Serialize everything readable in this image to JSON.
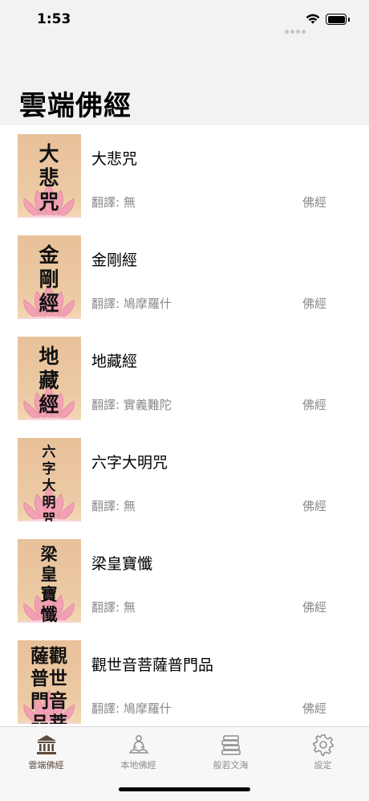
{
  "status": {
    "time": "1:53"
  },
  "nav": {
    "title": "雲端佛經"
  },
  "items": [
    {
      "thumb": "大悲咒",
      "title": "大悲咒",
      "translator": "翻譯: 無",
      "category": "佛經"
    },
    {
      "thumb": "金剛經",
      "title": "金剛經",
      "translator": "翻譯: 鳩摩羅什",
      "category": "佛經"
    },
    {
      "thumb": "地藏經",
      "title": "地藏經",
      "translator": "翻譯: 實義難陀",
      "category": "佛經"
    },
    {
      "thumb": "六字大明咒",
      "title": "六字大明咒",
      "translator": "翻譯: 無",
      "category": "佛經"
    },
    {
      "thumb": "梁皇寶懺",
      "title": "梁皇寶懺",
      "translator": "翻譯: 無",
      "category": "佛經"
    },
    {
      "thumb": "薩觀普世門音品菩",
      "title": "觀世音菩薩普門品",
      "translator": "翻譯: 鳩摩羅什",
      "category": "佛經"
    }
  ],
  "tabs": [
    {
      "label": "雲端佛經",
      "icon": "temple-icon"
    },
    {
      "label": "本地佛經",
      "icon": "meditation-icon"
    },
    {
      "label": "般若文海",
      "icon": "books-icon"
    },
    {
      "label": "設定",
      "icon": "gear-icon"
    }
  ],
  "colors": {
    "active_tab": "#5d4a3d",
    "inactive_tab": "#8e8e93",
    "thumb_bg": "#ecc9a4"
  }
}
